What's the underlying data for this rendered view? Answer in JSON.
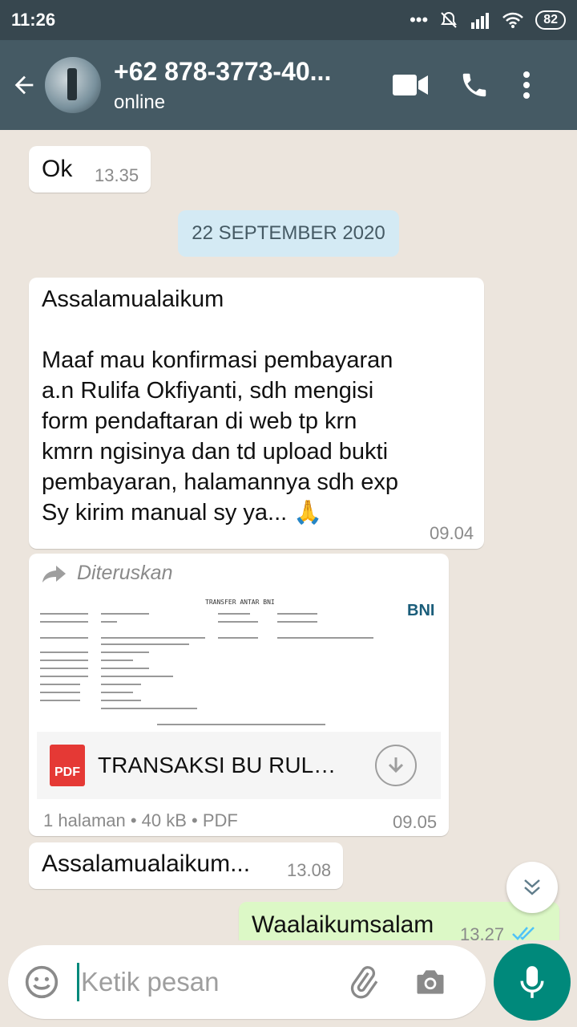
{
  "status_bar": {
    "time": "11:26",
    "dots": "•••",
    "battery": "82"
  },
  "header": {
    "contact_name": "+62 878-3773-40...",
    "status": "online"
  },
  "messages": [
    {
      "text": "Ok",
      "time": "13.35"
    },
    {
      "date_separator": "22 SEPTEMBER 2020"
    },
    {
      "text": "Assalamualaikum\n\nMaaf mau konfirmasi pembayaran\na.n Rulifa Okfiyanti, sdh mengisi\nform pendaftaran di web tp krn\nkmrn ngisinya dan td upload bukti\npembayaran, halamannya sdh exp\nSy kirim manual sy ya... 🙏",
      "time": "09.04"
    },
    {
      "forward_label": "Diteruskan",
      "doc_name": "TRANSAKSI BU RULI...",
      "doc_meta": "1 halaman • 40 kB • PDF",
      "time": "09.05",
      "pdf_badge": "PDF",
      "doc_preview_title": "TRANSFER ANTAR BNI",
      "doc_preview_brand": "BNI"
    },
    {
      "text": "Assalamualaikum...",
      "time": "13.08"
    },
    {
      "text": "Waalaikumsalam",
      "time": "13.27",
      "outgoing": true
    }
  ],
  "input": {
    "placeholder": "Ketik pesan"
  },
  "colors": {
    "header": "#455a64",
    "status_bar": "#37474f",
    "accent": "#00897b",
    "outgoing_bubble": "#dcf8c6",
    "read_ticks": "#4fc3f7"
  },
  "icons": [
    "back-arrow-icon",
    "video-call-icon",
    "phone-icon",
    "more-vert-icon",
    "forward-icon",
    "pdf-icon",
    "download-icon",
    "chevron-down-icon",
    "emoji-icon",
    "attach-icon",
    "camera-icon",
    "mic-icon",
    "double-check-icon"
  ]
}
